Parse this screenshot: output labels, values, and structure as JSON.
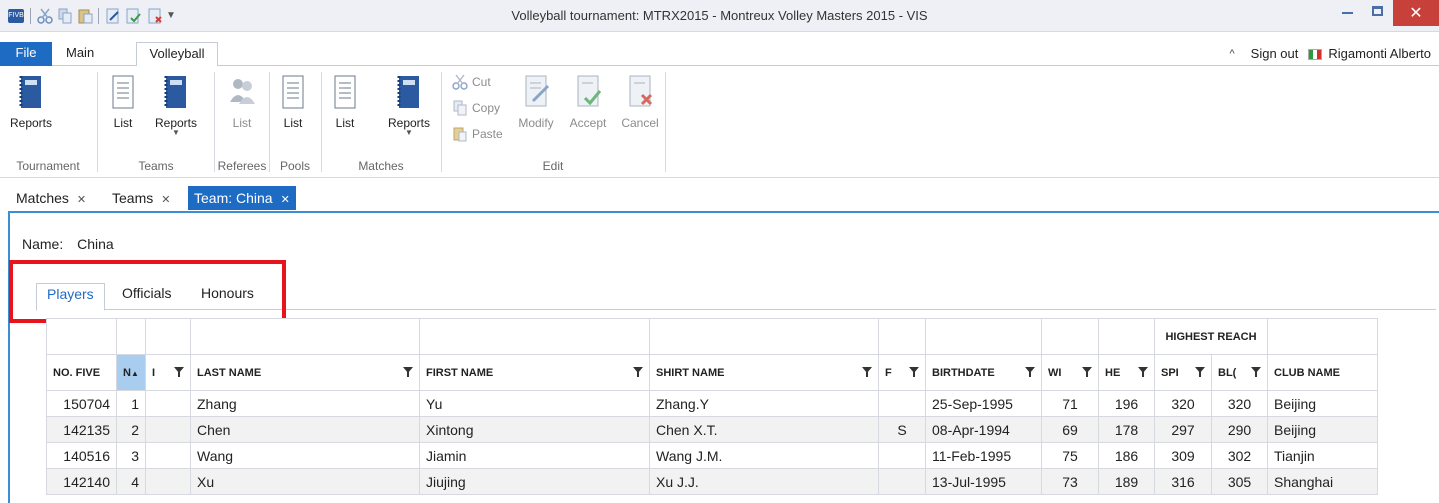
{
  "window": {
    "title": "Volleyball tournament: MTRX2015 - Montreux Volley Masters 2015 - VIS",
    "logo_text": "FIVB"
  },
  "ribbon_tabs": {
    "file": "File",
    "main": "Main",
    "volleyball": "Volleyball"
  },
  "user": {
    "sign_out": "Sign out",
    "name": "Rigamonti Alberto"
  },
  "ribbon": {
    "tournament": {
      "reports": "Reports",
      "group": "Tournament"
    },
    "teams": {
      "list": "List",
      "reports": "Reports",
      "group": "Teams"
    },
    "referees": {
      "list": "List",
      "group": "Referees"
    },
    "pools": {
      "list": "List",
      "group": "Pools"
    },
    "matches": {
      "list": "List",
      "reports": "Reports",
      "group": "Matches"
    },
    "edit": {
      "cut": "Cut",
      "copy": "Copy",
      "paste": "Paste",
      "modify": "Modify",
      "accept": "Accept",
      "cancel": "Cancel",
      "group": "Edit"
    }
  },
  "doc_tabs": {
    "matches": "Matches",
    "teams": "Teams",
    "team_china": "Team: China"
  },
  "team": {
    "name_label": "Name:",
    "name_value": "China"
  },
  "panel_tabs": {
    "players": "Players",
    "officials": "Officials",
    "honours": "Honours"
  },
  "grid": {
    "band_highest_reach": "HIGHEST REACH",
    "columns": {
      "no_fivb": "NO. FIVE",
      "no": "N",
      "l": "I",
      "last_name": "LAST NAME",
      "first_name": "FIRST NAME",
      "shirt_name": "SHIRT NAME",
      "f": "F",
      "birthdate": "BIRTHDATE",
      "weight": "WI",
      "height": "HE",
      "spike": "SPI",
      "block": "BL(",
      "club_name": "CLUB NAME"
    },
    "rows": [
      {
        "no_fivb": "150704",
        "no": "1",
        "l": "",
        "last": "Zhang",
        "first": "Yu",
        "shirt": "Zhang.Y",
        "f": "",
        "birth": "25-Sep-1995",
        "weight": "71",
        "height": "196",
        "spike": "320",
        "block": "320",
        "club": "Beijing"
      },
      {
        "no_fivb": "142135",
        "no": "2",
        "l": "",
        "last": "Chen",
        "first": "Xintong",
        "shirt": "Chen X.T.",
        "f": "S",
        "birth": "08-Apr-1994",
        "weight": "69",
        "height": "178",
        "spike": "297",
        "block": "290",
        "club": "Beijing"
      },
      {
        "no_fivb": "140516",
        "no": "3",
        "l": "",
        "last": "Wang",
        "first": "Jiamin",
        "shirt": "Wang J.M.",
        "f": "",
        "birth": "11-Feb-1995",
        "weight": "75",
        "height": "186",
        "spike": "309",
        "block": "302",
        "club": "Tianjin"
      },
      {
        "no_fivb": "142140",
        "no": "4",
        "l": "",
        "last": "Xu",
        "first": "Jiujing",
        "shirt": "Xu J.J.",
        "f": "",
        "birth": "13-Jul-1995",
        "weight": "73",
        "height": "189",
        "spike": "316",
        "block": "305",
        "club": "Shanghai"
      }
    ]
  },
  "colors": {
    "accent": "#1e6bc4",
    "highlight": "#e8131b",
    "close": "#c7413a"
  }
}
